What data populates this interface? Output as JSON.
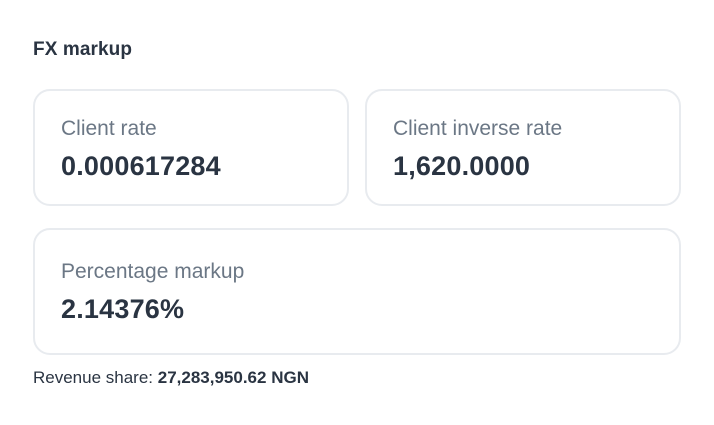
{
  "section": {
    "title": "FX markup"
  },
  "cards": {
    "client_rate": {
      "label": "Client rate",
      "value": "0.000617284"
    },
    "client_inverse_rate": {
      "label": "Client inverse rate",
      "value": "1,620.0000"
    },
    "percentage_markup": {
      "label": "Percentage markup",
      "value": "2.14376%"
    }
  },
  "revenue_share": {
    "label": "Revenue share:",
    "value": "27,283,950.62 NGN"
  },
  "colors": {
    "text_primary": "#2a3442",
    "text_secondary": "#6b7785",
    "card_border": "#e8ebef",
    "background": "#ffffff"
  }
}
